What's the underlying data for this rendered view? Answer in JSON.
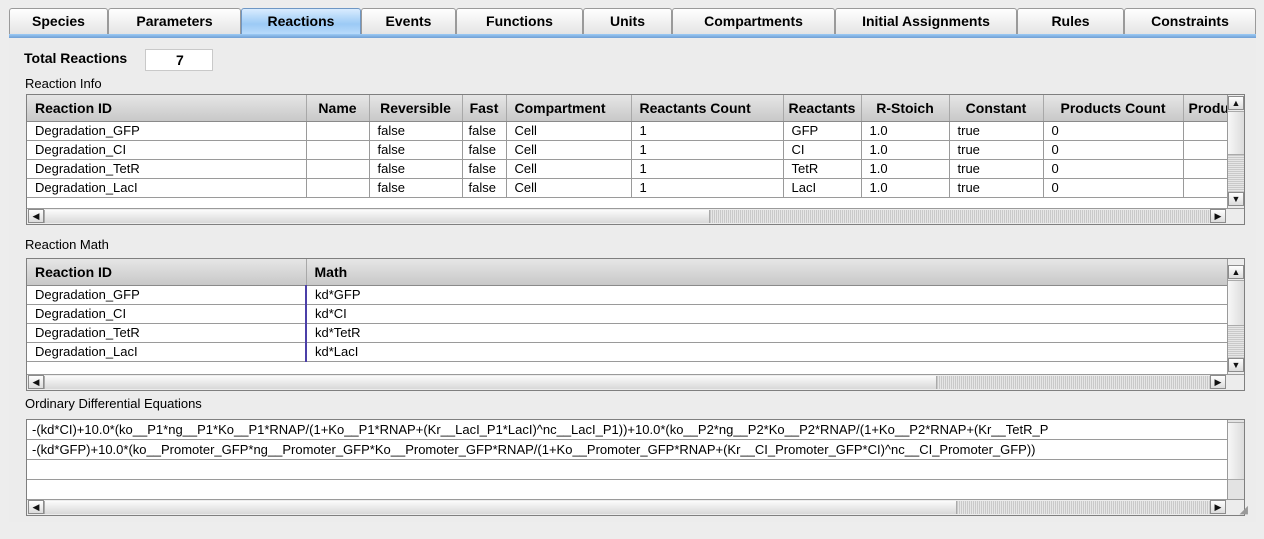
{
  "tabs": [
    {
      "label": "Species",
      "active": false
    },
    {
      "label": "Parameters",
      "active": false
    },
    {
      "label": "Reactions",
      "active": true
    },
    {
      "label": "Events",
      "active": false
    },
    {
      "label": "Functions",
      "active": false
    },
    {
      "label": "Units",
      "active": false
    },
    {
      "label": "Compartments",
      "active": false
    },
    {
      "label": "Initial Assignments",
      "active": false
    },
    {
      "label": "Rules",
      "active": false
    },
    {
      "label": "Constraints",
      "active": false
    }
  ],
  "total": {
    "label": "Total Reactions",
    "value": "7"
  },
  "reaction_info": {
    "title": "Reaction Info",
    "columns": [
      "Reaction ID",
      "Name",
      "Reversible",
      "Fast",
      "Compartment",
      "Reactants Count",
      "Reactants",
      "R-Stoich",
      "Constant",
      "Products Count",
      "Produ"
    ],
    "rows": [
      [
        "Degradation_GFP",
        "",
        "false",
        "false",
        "Cell",
        "1",
        "GFP",
        "1.0",
        "true",
        "0",
        ""
      ],
      [
        "Degradation_CI",
        "",
        "false",
        "false",
        "Cell",
        "1",
        "CI",
        "1.0",
        "true",
        "0",
        ""
      ],
      [
        "Degradation_TetR",
        "",
        "false",
        "false",
        "Cell",
        "1",
        "TetR",
        "1.0",
        "true",
        "0",
        ""
      ],
      [
        "Degradation_LacI",
        "",
        "false",
        "false",
        "Cell",
        "1",
        "LacI",
        "1.0",
        "true",
        "0",
        ""
      ]
    ]
  },
  "reaction_math": {
    "title": "Reaction Math",
    "columns": [
      "Reaction ID",
      "Math"
    ],
    "rows": [
      [
        "Degradation_GFP",
        "kd*GFP"
      ],
      [
        "Degradation_CI",
        "kd*CI"
      ],
      [
        "Degradation_TetR",
        "kd*TetR"
      ],
      [
        "Degradation_LacI",
        "kd*LacI"
      ]
    ]
  },
  "ode": {
    "title": "Ordinary Differential Equations",
    "lines": [
      "-(kd*CI)+10.0*(ko__P1*ng__P1*Ko__P1*RNAP/(1+Ko__P1*RNAP+(Kr__LacI_P1*LacI)^nc__LacI_P1))+10.0*(ko__P2*ng__P2*Ko__P2*RNAP/(1+Ko__P2*RNAP+(Kr__TetR_P",
      "-(kd*GFP)+10.0*(ko__Promoter_GFP*ng__Promoter_GFP*Ko__Promoter_GFP*RNAP/(1+Ko__Promoter_GFP*RNAP+(Kr__CI_Promoter_GFP*CI)^nc__CI_Promoter_GFP))",
      "",
      ""
    ]
  },
  "icons": {
    "scroll_up": "arrow-up-icon",
    "scroll_down": "arrow-down-icon",
    "scroll_left": "arrow-left-icon",
    "scroll_right": "arrow-right-icon"
  },
  "colors": {
    "active_tab": "#9ccaf5",
    "tab_underline": "#6f9fd4",
    "math_divider": "#4b3fa8"
  }
}
